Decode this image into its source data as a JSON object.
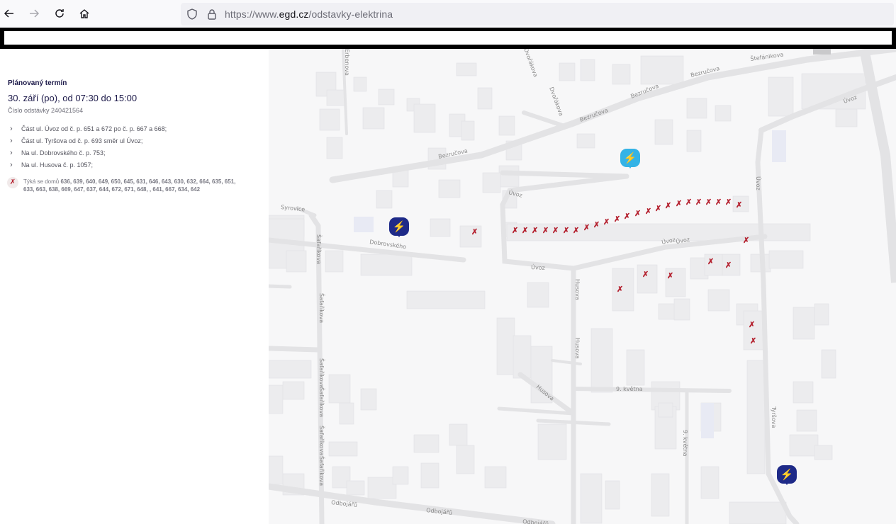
{
  "browser": {
    "url_prefix": "https://www.",
    "url_domain": "egd.cz",
    "url_path": "/odstavky-elektrina",
    "icons": [
      "back-arrow-icon",
      "forward-arrow-icon",
      "reload-icon",
      "home-icon",
      "shield-icon",
      "lock-icon"
    ]
  },
  "outage": {
    "heading": "Plánovaný termín",
    "date": "30. září (po), od 07:30 do 15:00",
    "number_label": "Číslo odstávky 240421564",
    "streets": [
      "Část ul. Úvoz od č. p. 651 a 672 po č. p. 667 a 668;",
      "Část ul. Tyršova od č. p. 693 směr ul Úvoz;",
      "Na ul. Dobrovského č. p. 753;",
      "Na ul. Husova č. p. 1057;"
    ],
    "houses_prefix": "Týká se domů",
    "houses_numbers": "636, 639, 640, 649, 650, 645, 631, 646, 643, 630, 632, 664, 635, 651, 633, 663, 638, 669, 647, 637, 644, 672, 671, 648, , 641, 667, 634, 642",
    "colors": {
      "heading": "#1d1a4a",
      "marker_dark": "#1e2a88",
      "marker_light": "#34b3e6",
      "house_mark": "#b4202e"
    }
  },
  "map": {
    "street_labels": {
      "s1": "Bezručova",
      "s2": "Bezručova",
      "s3": "Bezručova",
      "s4": "Bezručova",
      "s5": "Štefánikova",
      "s6": "Úvoz",
      "s7": "Úvoz",
      "s8": "Úvoz",
      "s9": "Úvoz",
      "s10": "Úvoz",
      "s11": "Dobrovského",
      "s12": "Syrovice",
      "s13": "Šafaříkova",
      "s14": "Šafaříkova",
      "s15": "Šafaříkova",
      "s16": "Šafaříkova",
      "s17": "Šafaříkova",
      "s18": "Šafaříkova",
      "s19": "Husova",
      "s20": "Husova",
      "s21": "Husova",
      "s22": "9. května",
      "s23": "9. května",
      "s24": "Tyršova",
      "s25": "Úvoz",
      "s26": "Odbojářů",
      "s27": "Odbojářů",
      "s28": "Odbojářů",
      "s29": "Dvořákova",
      "s30": "Dvořákova",
      "s31": "Erbenova"
    },
    "marker_icons": [
      "plug-icon",
      "plug-icon",
      "plug-icon"
    ],
    "house_mark_glyph": "✗"
  }
}
